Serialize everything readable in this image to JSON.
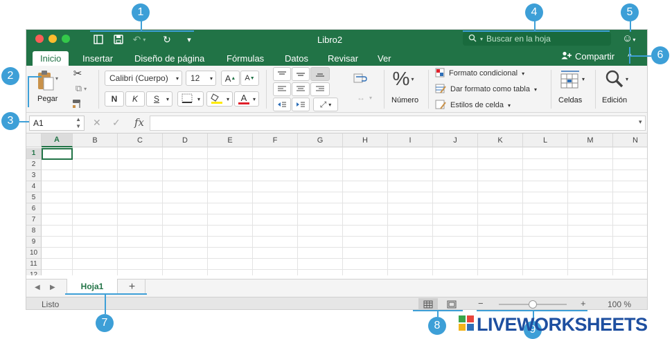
{
  "window": {
    "title": "Libro2"
  },
  "search": {
    "placeholder": "Buscar en la hoja",
    "icon": "search-icon"
  },
  "tabs": [
    "Inicio",
    "Insertar",
    "Diseño de página",
    "Fórmulas",
    "Datos",
    "Revisar",
    "Ver"
  ],
  "share_label": "Compartir",
  "ribbon": {
    "paste_label": "Pegar",
    "font_name": "Calibri (Cuerpo)",
    "font_size": "12",
    "bold": "N",
    "italic": "K",
    "underline": "S",
    "grow_font": "A",
    "shrink_font": "A",
    "font_color_letter": "A",
    "number_symbol": "%",
    "number_label": "Número",
    "cond_format": "Formato condicional",
    "table_format": "Dar formato como tabla",
    "cell_styles": "Estilos de celda",
    "cells_label": "Celdas",
    "editing_label": "Edición"
  },
  "formula_bar": {
    "name_box": "A1",
    "fx": "fx"
  },
  "columns": [
    "A",
    "B",
    "C",
    "D",
    "E",
    "F",
    "G",
    "H",
    "I",
    "J",
    "K",
    "L",
    "M",
    "N"
  ],
  "rows": [
    "1",
    "2",
    "3",
    "4",
    "5",
    "6",
    "7",
    "8",
    "9",
    "10",
    "11",
    "12"
  ],
  "sheets": [
    "Hoja1"
  ],
  "add_sheet": "+",
  "status": {
    "ready": "Listo",
    "zoom": "100 %",
    "zoom_minus": "−",
    "zoom_plus": "+",
    "zoom_level": 0.5
  },
  "callouts": [
    "1",
    "2",
    "3",
    "4",
    "5",
    "6",
    "7",
    "8",
    "9"
  ],
  "logo": {
    "text": "LIVEWORKSHEETS"
  },
  "colors": {
    "excel_green": "#217346",
    "callout_blue": "#3d9fd7"
  }
}
